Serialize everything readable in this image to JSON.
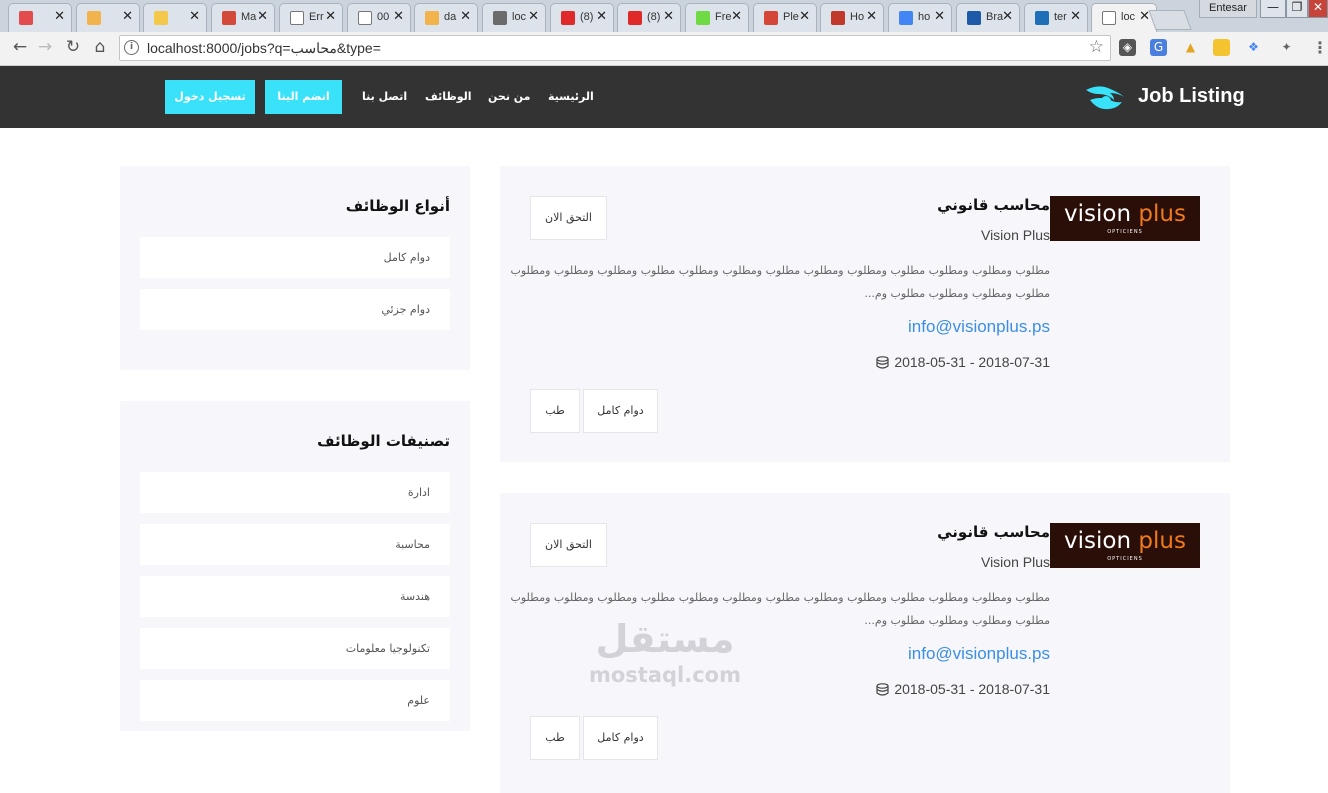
{
  "browser": {
    "tabs": [
      {
        "title": "",
        "icon": "download-icon",
        "color": "#e24c4c"
      },
      {
        "title": "",
        "icon": "pma-icon",
        "color": "#f3b34c"
      },
      {
        "title": "",
        "icon": "bulb-icon",
        "color": "#f4c84a"
      },
      {
        "title": "Ma",
        "icon": "swirl-icon",
        "color": "#d44a3a"
      },
      {
        "title": "Err",
        "icon": "page-icon",
        "color": "#ffffff"
      },
      {
        "title": "00",
        "icon": "page-icon",
        "color": "#ffffff"
      },
      {
        "title": "da",
        "icon": "pma-icon",
        "color": "#f3b34c"
      },
      {
        "title": "loc",
        "icon": "bootstrap-icon",
        "color": "#6b6b6b"
      },
      {
        "title": "(8)",
        "icon": "youtube-icon",
        "color": "#e02a2a"
      },
      {
        "title": "(8)",
        "icon": "youtube-icon",
        "color": "#e02a2a"
      },
      {
        "title": "Fre",
        "icon": "upwork-icon",
        "color": "#6fda44"
      },
      {
        "title": "Ple",
        "icon": "gmail-icon",
        "color": "#d44638"
      },
      {
        "title": "Ho",
        "icon": "flag-icon",
        "color": "#c0392b"
      },
      {
        "title": "ho",
        "icon": "google-icon",
        "color": "#4285f4"
      },
      {
        "title": "Bra",
        "icon": "bracket-icon",
        "color": "#1e5aa8"
      },
      {
        "title": "ter",
        "icon": "tm-icon",
        "color": "#1e6fb8"
      },
      {
        "title": "loc",
        "icon": "page-icon",
        "color": "#ffffff",
        "active": true
      }
    ],
    "profile_name": "Entesar",
    "window_controls": {
      "minimize": "—",
      "maximize": "❐",
      "close": "✕"
    },
    "url": "localhost:8000/jobs?q=محاسب&type=",
    "nav": {
      "back": "←",
      "forward": "→",
      "reload": "↻",
      "home": "⌂"
    },
    "star": "☆",
    "menu": "⋮"
  },
  "site": {
    "brand": "Job Listing",
    "nav_links": [
      "الرئيسية",
      "من نحن",
      "الوظائف",
      "اتصل بنا"
    ],
    "join_button": "انضم الينا",
    "login_button": "تسجيل دخول"
  },
  "sidebar": {
    "job_types": {
      "title": "أنواع الوظائف",
      "items": [
        "دوام كامل",
        "دوام جزئي"
      ]
    },
    "categories": {
      "title": "تصنيفات الوظائف",
      "items": [
        "ادارة",
        "محاسبة",
        "هندسة",
        "تكنولوجيا معلومات",
        "علوم"
      ]
    }
  },
  "jobs": [
    {
      "logo_main_a": "vision",
      "logo_main_b": "plus",
      "logo_sub": "OPTICIENS",
      "title": "محاسب قانوني",
      "company": "Vision Plus",
      "description": "مطلوب ومطلوب ومطلوب مطلوب ومطلوب ومطلوب مطلوب ومطلوب ومطلوب مطلوب ومطلوب ومطلوب ومطلوب مطلوب ومطلوب ومطلوب مطلوب وم...",
      "email": "info@visionplus.ps",
      "dates": "2018-05-31 - 2018-07-31",
      "apply_label": "التحق الان",
      "tags": [
        "دوام كامل",
        "طب"
      ]
    },
    {
      "logo_main_a": "vision",
      "logo_main_b": "plus",
      "logo_sub": "OPTICIENS",
      "title": "محاسب قانوني",
      "company": "Vision Plus",
      "description": "مطلوب ومطلوب ومطلوب مطلوب ومطلوب ومطلوب مطلوب ومطلوب ومطلوب مطلوب ومطلوب ومطلوب ومطلوب مطلوب ومطلوب ومطلوب مطلوب وم...",
      "email": "info@visionplus.ps",
      "dates": "2018-05-31 - 2018-07-31",
      "apply_label": "التحق الان",
      "tags": [
        "دوام كامل",
        "طب"
      ]
    }
  ],
  "watermark": {
    "arabic": "مستقل",
    "latin": "mostaql.com"
  },
  "colors": {
    "header_bg": "#333333",
    "accent": "#39e2f9",
    "link": "#3a8ee6",
    "card_bg": "#f7f7fb"
  }
}
